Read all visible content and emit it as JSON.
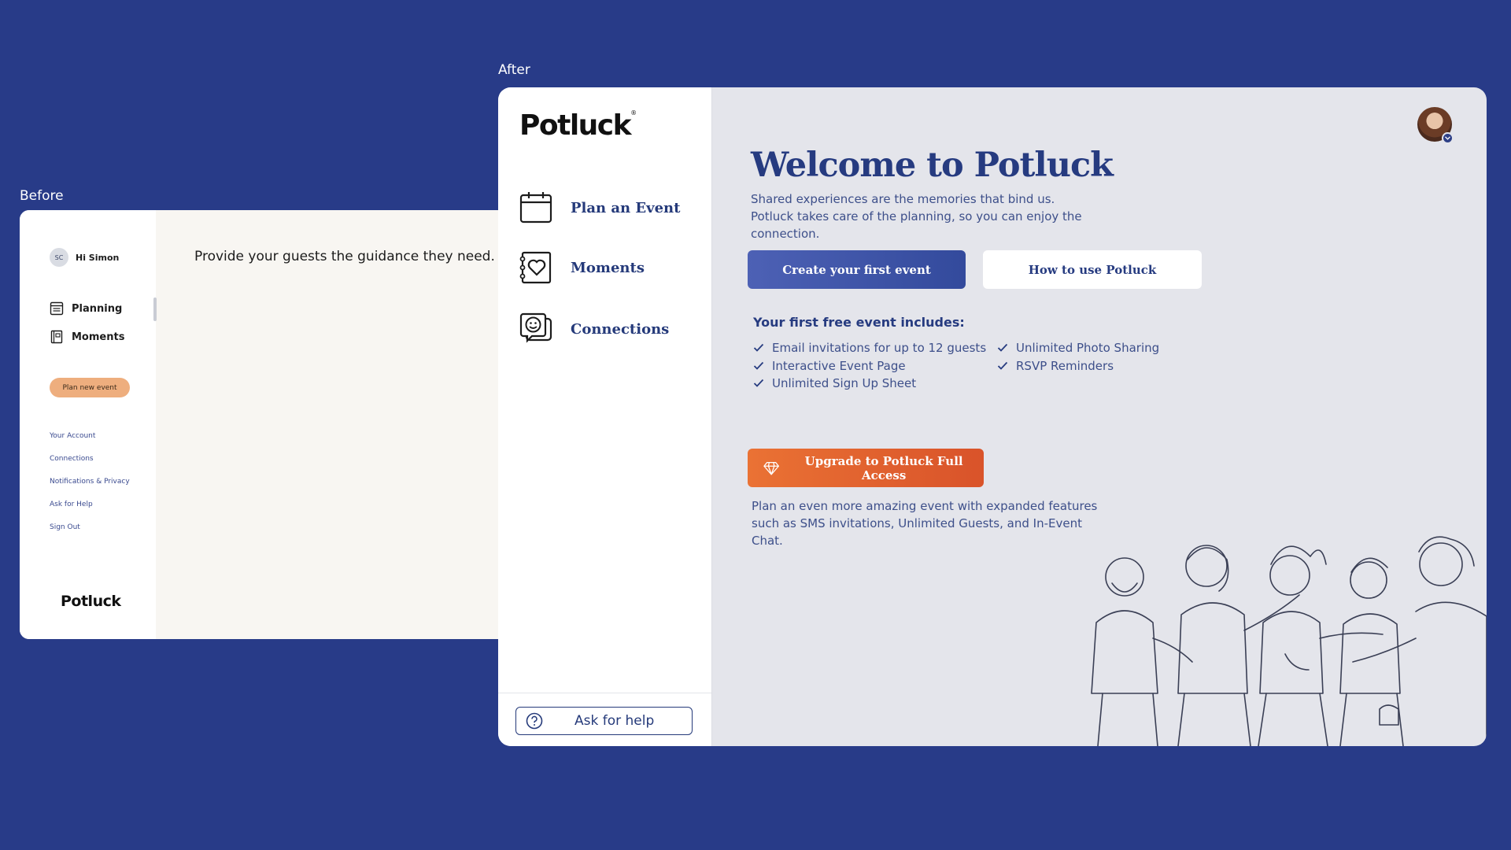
{
  "labels": {
    "before": "Before",
    "after": "After"
  },
  "before": {
    "avatar_initials": "SC",
    "greeting": "Hi Simon",
    "nav": [
      {
        "label": "Planning",
        "icon": "calendar-list-icon"
      },
      {
        "label": "Moments",
        "icon": "journal-icon"
      }
    ],
    "plan_button": "Plan new event",
    "links": [
      "Your Account",
      "Connections",
      "Notifications & Privacy",
      "Ask for Help",
      "Sign Out"
    ],
    "logo": "Potluck",
    "guidance": "Provide your guests the guidance they need."
  },
  "after": {
    "logo": "Potluck",
    "logo_mark": "®",
    "nav": [
      {
        "label": "Plan an Event",
        "icon": "calendar-icon"
      },
      {
        "label": "Moments",
        "icon": "heart-journal-icon"
      },
      {
        "label": "Connections",
        "icon": "smile-chat-icon"
      }
    ],
    "help_button": "Ask for help",
    "title": "Welcome to Potluck",
    "subtitle": "Shared experiences are the memories that bind us. Potluck takes care of the planning, so you can enjoy the connection.",
    "primary_button": "Create your first event",
    "secondary_button": "How to use Potluck",
    "includes_title": "Your first free event includes:",
    "features_left": [
      "Email invitations for up to 12 guests",
      "Interactive Event Page",
      "Unlimited Sign Up Sheet"
    ],
    "features_right": [
      "Unlimited Photo Sharing",
      "RSVP Reminders"
    ],
    "upgrade_button": "Upgrade to Potluck Full Access",
    "upgrade_note": "Plan an even more amazing event with expanded features such as SMS invitations, Unlimited Guests, and In-Event Chat."
  },
  "colors": {
    "background": "#283b88",
    "brand_navy": "#263b80",
    "accent_orange": "#e2622f",
    "before_button": "#eeae7e"
  }
}
